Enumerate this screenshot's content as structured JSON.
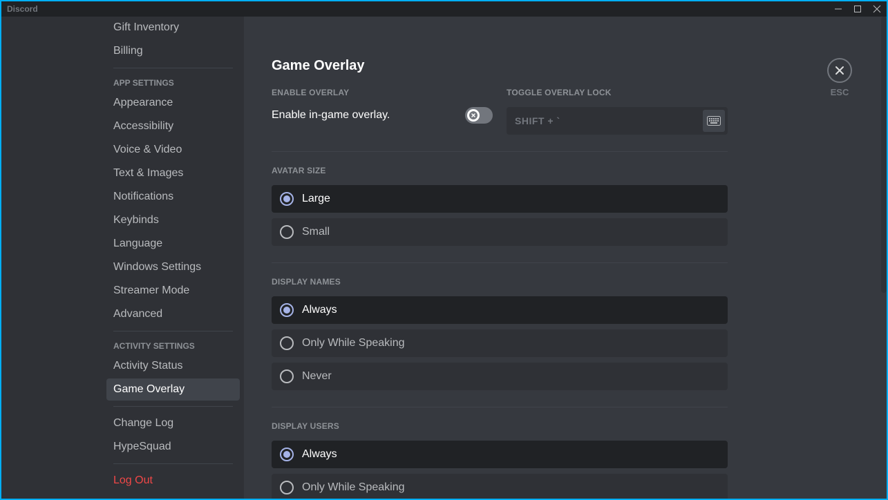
{
  "window": {
    "title": "Discord"
  },
  "sidebar": {
    "top_items": [
      {
        "label": "Gift Inventory"
      },
      {
        "label": "Billing"
      }
    ],
    "app_header": "App Settings",
    "app_items": [
      {
        "label": "Appearance"
      },
      {
        "label": "Accessibility"
      },
      {
        "label": "Voice & Video"
      },
      {
        "label": "Text & Images"
      },
      {
        "label": "Notifications"
      },
      {
        "label": "Keybinds"
      },
      {
        "label": "Language"
      },
      {
        "label": "Windows Settings"
      },
      {
        "label": "Streamer Mode"
      },
      {
        "label": "Advanced"
      }
    ],
    "activity_header": "Activity Settings",
    "activity_items": [
      {
        "label": "Activity Status"
      },
      {
        "label": "Game Overlay",
        "selected": true
      }
    ],
    "misc_items": [
      {
        "label": "Change Log"
      },
      {
        "label": "HypeSquad"
      }
    ],
    "logout_label": "Log Out"
  },
  "main": {
    "title": "Game Overlay",
    "enable_label": "Enable Overlay",
    "enable_text": "Enable in-game overlay.",
    "toggle_lock_label": "Toggle Overlay Lock",
    "keybind": "SHIFT + `",
    "avatar_size_label": "Avatar Size",
    "avatar_options": [
      {
        "label": "Large",
        "selected": true
      },
      {
        "label": "Small"
      }
    ],
    "display_names_label": "Display Names",
    "display_names_options": [
      {
        "label": "Always",
        "selected": true
      },
      {
        "label": "Only While Speaking"
      },
      {
        "label": "Never"
      }
    ],
    "display_users_label": "Display Users",
    "display_users_options": [
      {
        "label": "Always",
        "selected": true
      },
      {
        "label": "Only While Speaking"
      }
    ],
    "close_label": "ESC"
  }
}
